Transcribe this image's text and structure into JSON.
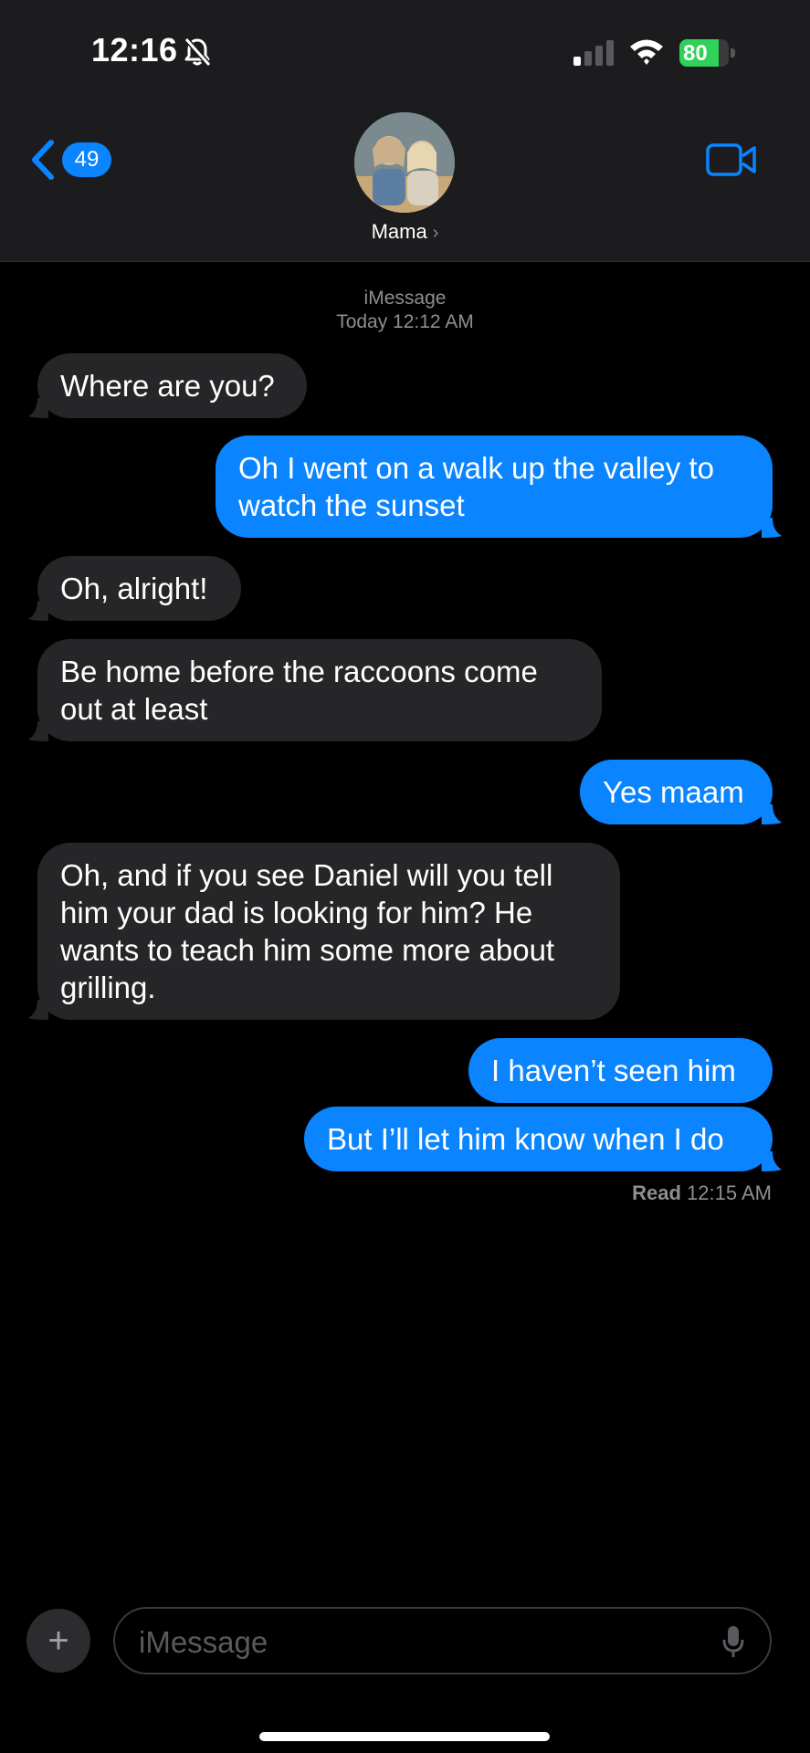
{
  "status_bar": {
    "time": "12:16",
    "battery": "80",
    "battery_level": 0.8
  },
  "header": {
    "back_count": "49",
    "contact_name": "Mama"
  },
  "thread": {
    "service": "iMessage",
    "timestamp": "Today 12:12 AM",
    "messages": [
      {
        "from": "them",
        "text": "Where are you?"
      },
      {
        "from": "me",
        "text": "Oh I went on a walk up the valley to watch the sunset"
      },
      {
        "from": "them",
        "text": "Oh, alright!"
      },
      {
        "from": "them",
        "text": "Be home before the raccoons come out at least"
      },
      {
        "from": "me",
        "text": "Yes maam"
      },
      {
        "from": "them",
        "text": "Oh, and if you see Daniel will you tell him your dad is looking for him? He wants to teach him some more about grilling."
      },
      {
        "from": "me",
        "text": "I haven’t seen him"
      },
      {
        "from": "me",
        "text": "But I’ll let him know when I do"
      }
    ],
    "read_label": "Read",
    "read_time": "12:15 AM"
  },
  "composer": {
    "placeholder": "iMessage"
  },
  "colors": {
    "accent": "#0a84ff",
    "incoming": "#262628",
    "battery": "#30d158"
  },
  "icons": [
    "bell-slash-icon",
    "cellular-signal-icon",
    "wifi-icon",
    "battery-icon",
    "back-chevron-icon",
    "video-camera-icon",
    "plus-icon",
    "microphone-icon"
  ]
}
